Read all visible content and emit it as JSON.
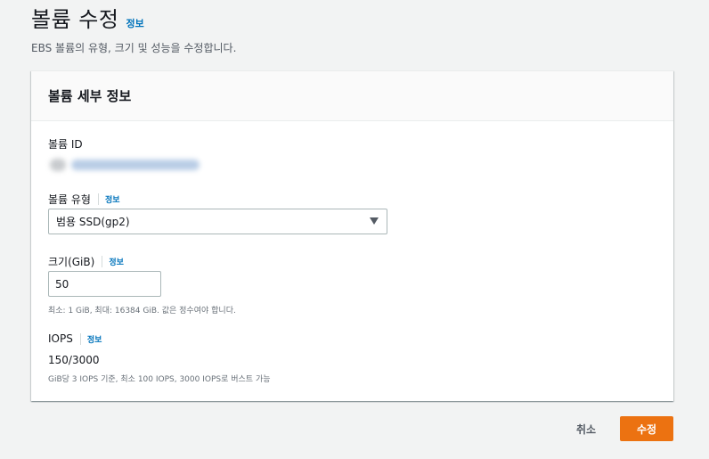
{
  "header": {
    "title": "볼륨 수정",
    "info_link": "정보",
    "subtitle": "EBS 볼륨의 유형, 크기 및 성능을 수정합니다."
  },
  "panel": {
    "title": "볼륨 세부 정보",
    "volume_id": {
      "label": "볼륨 ID"
    },
    "volume_type": {
      "label": "볼륨 유형",
      "info_link": "정보",
      "selected": "범용 SSD(gp2)"
    },
    "size": {
      "label": "크기(GiB)",
      "info_link": "정보",
      "value": "50",
      "hint": "최소: 1 GiB, 최대: 16384 GiB. 값은 정수여야 합니다."
    },
    "iops": {
      "label": "IOPS",
      "info_link": "정보",
      "value": "150/3000",
      "hint": "GiB당 3 IOPS 기준, 최소 100 IOPS, 3000 IOPS로 버스트 가능"
    }
  },
  "footer": {
    "cancel_label": "취소",
    "submit_label": "수정"
  },
  "colors": {
    "accent": "#ec7211",
    "link": "#0073bb",
    "background": "#f2f3f3"
  }
}
